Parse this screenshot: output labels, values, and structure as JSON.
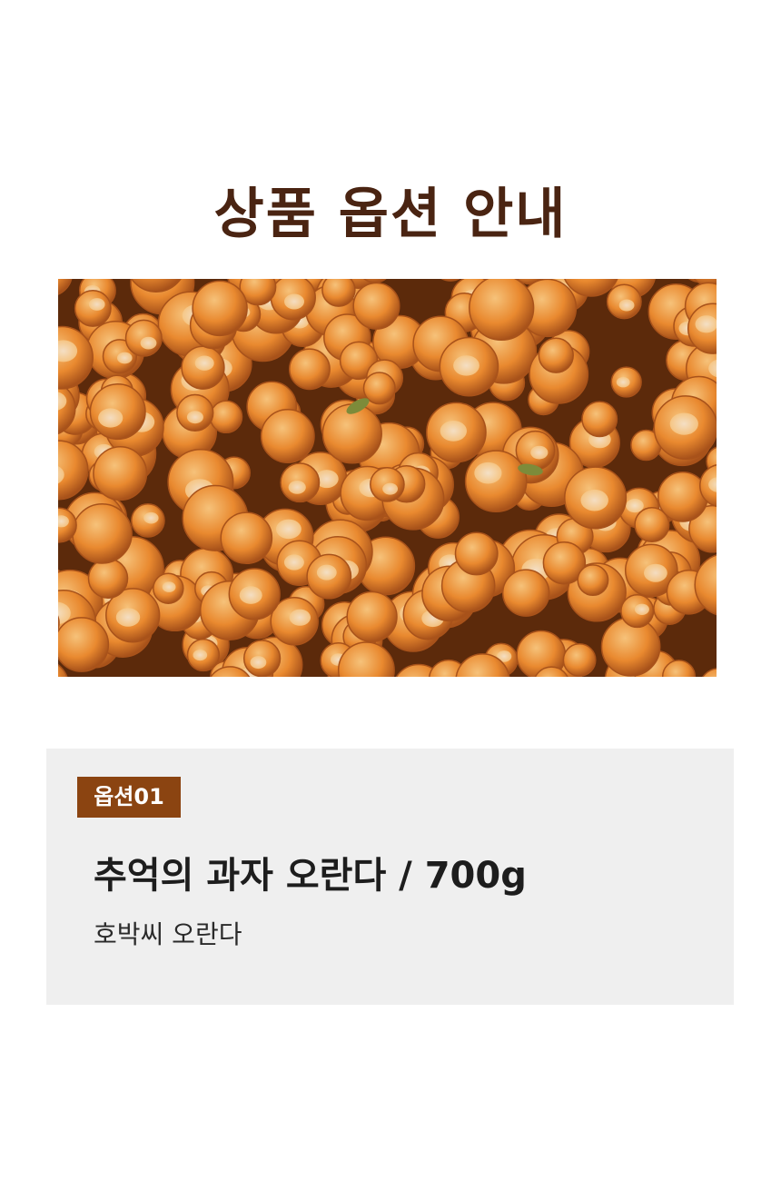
{
  "header": {
    "title": "상품 옵션 안내"
  },
  "photo": {
    "icon": "product-photo-pumpkin-seed-puffed-snack",
    "colors": {
      "base": "#a8521a",
      "puff": "#e9892f",
      "highlight": "#f6c27a",
      "crumb": "#f4e4cf",
      "shadow": "#5c2a0b",
      "seed": "#7d8b3a"
    }
  },
  "option": {
    "badge": "옵션01",
    "name": "추억의 과자 오란다 / 700g",
    "description": "호박씨 오란다",
    "colors": {
      "badge_bg": "#8b4411",
      "card_bg": "#efefef"
    }
  }
}
